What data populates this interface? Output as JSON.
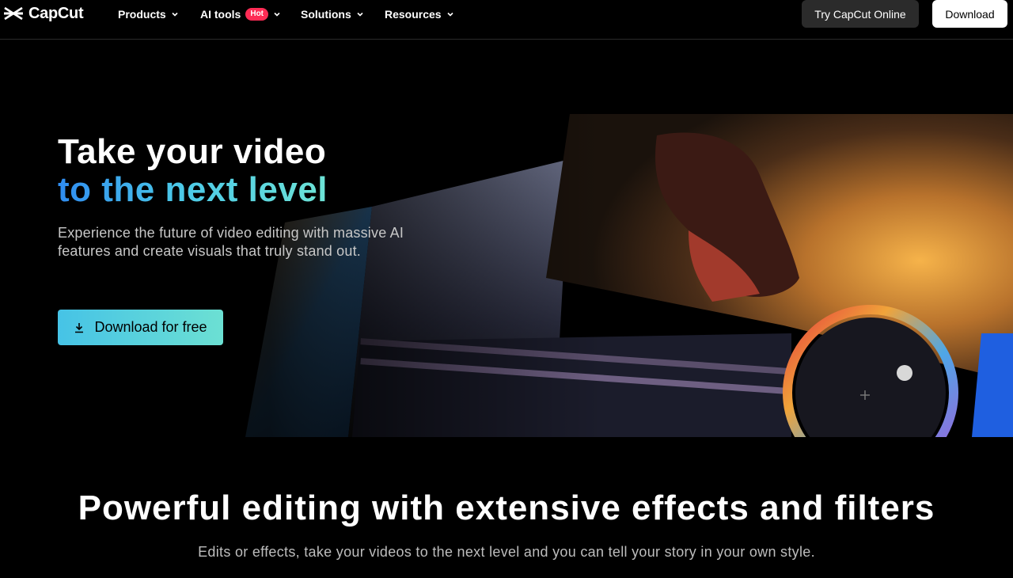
{
  "nav": {
    "logo_text": "CapCut",
    "items": [
      {
        "label": "Products"
      },
      {
        "label": "AI tools",
        "badge": "Hot"
      },
      {
        "label": "Solutions"
      },
      {
        "label": "Resources"
      }
    ],
    "try_online_label": "Try CapCut Online",
    "download_label": "Download"
  },
  "hero": {
    "title_line1": "Take your video",
    "title_line2": "to the next level",
    "subtitle": "Experience the future of video editing with massive AI features and create visuals that truly stand out.",
    "cta_label": "Download for free"
  },
  "section": {
    "title": "Powerful editing with extensive effects and filters",
    "subtitle": "Edits or effects, take your videos to the next level and you can tell your story in your own style."
  },
  "colors": {
    "accent_cyan": "#46c3e6",
    "accent_teal": "#6ce0d3",
    "hot_badge": "#fe2c55",
    "background": "#000000"
  },
  "icons": {
    "logo": "capcut-logo-icon",
    "dropdown": "chevron-down-icon",
    "download": "download-icon"
  }
}
